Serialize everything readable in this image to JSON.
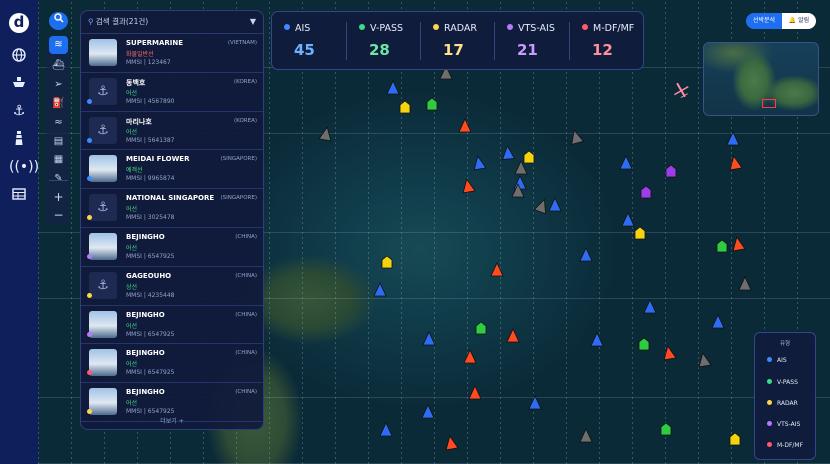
{
  "search": {
    "placeholder": "검색 결과(21건)"
  },
  "stats": [
    {
      "label": "AIS",
      "value": "45",
      "color": "#3d8bff"
    },
    {
      "label": "V-PASS",
      "value": "28",
      "color": "#3ddc84"
    },
    {
      "label": "RADAR",
      "value": "17",
      "color": "#ffd54a"
    },
    {
      "label": "VTS-AIS",
      "value": "21",
      "color": "#b57bff"
    },
    {
      "label": "M-DF/MF",
      "value": "12",
      "color": "#ff5b6b"
    }
  ],
  "vessels": [
    {
      "name": "SUPERMARINE",
      "country": "(VIETNAM)",
      "type": "화물일반선",
      "type_color": "#ff6b6b",
      "mmsi": "MMSI  |  123467",
      "dot": "",
      "thumb": "ship"
    },
    {
      "name": "동백호",
      "country": "(KOREA)",
      "type": "어선",
      "type_color": "#3ddc84",
      "mmsi": "MMSI  |  4567890",
      "dot": "#3d8bff",
      "thumb": "anchor"
    },
    {
      "name": "마리나호",
      "country": "(KOREA)",
      "type": "어선",
      "type_color": "#3ddc84",
      "mmsi": "MMSI  |  5641387",
      "dot": "#3d8bff",
      "thumb": "anchor"
    },
    {
      "name": "MEIDAI FLOWER",
      "country": "(SINGAPORE)",
      "type": "예객선",
      "type_color": "#3ddc84",
      "mmsi": "MMSI  |  9965874",
      "dot": "#3d8bff",
      "thumb": "ship"
    },
    {
      "name": "NATIONAL SINGAPORE",
      "country": "(SINGAPORE)",
      "type": "어선",
      "type_color": "#3ddc84",
      "mmsi": "MMSI  |  3025478",
      "dot": "#ffd54a",
      "thumb": "anchor"
    },
    {
      "name": "BEJINGHO",
      "country": "(CHINA)",
      "type": "어선",
      "type_color": "#3ddc84",
      "mmsi": "MMSI  |  6547925",
      "dot": "#b57bff",
      "thumb": "ship"
    },
    {
      "name": "GAGEOUHO",
      "country": "(CHINA)",
      "type": "상선",
      "type_color": "#3ddc84",
      "mmsi": "MMSI  |  4235448",
      "dot": "#ffd54a",
      "thumb": "anchor"
    },
    {
      "name": "BEJINGHO",
      "country": "(CHINA)",
      "type": "어선",
      "type_color": "#3ddc84",
      "mmsi": "MMSI  |  6547925",
      "dot": "#b57bff",
      "thumb": "ship"
    },
    {
      "name": "BEJINGHO",
      "country": "(CHINA)",
      "type": "어선",
      "type_color": "#3ddc84",
      "mmsi": "MMSI  |  6547925",
      "dot": "#ff5b6b",
      "thumb": "ship"
    },
    {
      "name": "BEJINGHO",
      "country": "(CHINA)",
      "type": "어선",
      "type_color": "#3ddc84",
      "mmsi": "MMSI  |  6547925",
      "dot": "#ffd54a",
      "thumb": "ship"
    }
  ],
  "more_label": "더보기 +",
  "top_buttons": {
    "analysis": "선박분석",
    "alert": "🔔 알림"
  },
  "legend": {
    "title": "유형",
    "items": [
      {
        "label": "AIS",
        "color": "#3d8bff"
      },
      {
        "label": "V-PASS",
        "color": "#3ddc84"
      },
      {
        "label": "RADAR",
        "color": "#ffd54a"
      },
      {
        "label": "VTS-AIS",
        "color": "#b57bff"
      },
      {
        "label": "M-DF/MF",
        "color": "#ff5b6b"
      }
    ]
  },
  "nav_icons": [
    "logo-icon",
    "globe-icon",
    "ship-icon",
    "anchor-icon",
    "lighthouse-icon",
    "radio-tower-icon",
    "table-icon"
  ],
  "tool_icons": [
    "search-icon",
    "layers-icon",
    "ships-icon",
    "navigation-icon",
    "fuel-icon",
    "wind-icon",
    "list-icon",
    "map-icon",
    "ruler-icon",
    "zoom-in-icon",
    "zoom-out-icon"
  ]
}
